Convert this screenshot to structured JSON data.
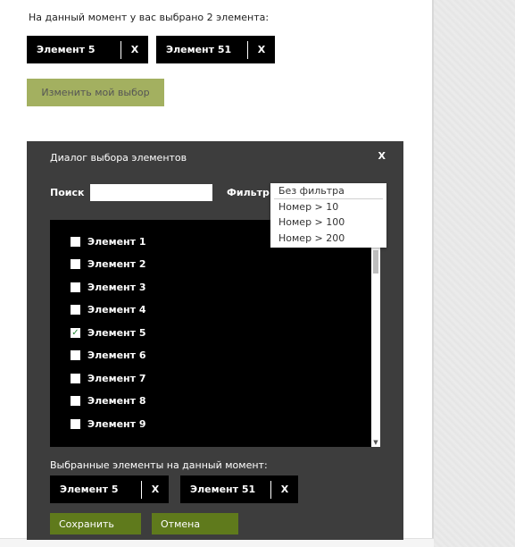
{
  "summary": {
    "text": "На данный момент у вас выбрано 2 элемента:",
    "chips": [
      {
        "label": "Элемент 5",
        "remove": "X"
      },
      {
        "label": "Элемент 51",
        "remove": "X"
      }
    ],
    "change_button": "Изменить мой выбор"
  },
  "dialog": {
    "title": "Диалог выбора элементов",
    "close": "X",
    "search_label": "Поиск",
    "search_value": "",
    "filter_label": "Фильтр",
    "filter_options": [
      "Без фильтра",
      "Номер > 10",
      "Номер > 100",
      "Номер > 200"
    ],
    "items": [
      {
        "label": "Элемент 1",
        "checked": false
      },
      {
        "label": "Элемент 2",
        "checked": false
      },
      {
        "label": "Элемент 3",
        "checked": false
      },
      {
        "label": "Элемент 4",
        "checked": false
      },
      {
        "label": "Элемент 5",
        "checked": true
      },
      {
        "label": "Элемент 6",
        "checked": false
      },
      {
        "label": "Элемент 7",
        "checked": false
      },
      {
        "label": "Элемент 8",
        "checked": false
      },
      {
        "label": "Элемент 9",
        "checked": false
      }
    ],
    "selected_label": "Выбранные элементы на данный момент:",
    "selected_chips": [
      {
        "label": "Элемент 5",
        "remove": "X"
      },
      {
        "label": "Элемент 51",
        "remove": "X"
      }
    ],
    "save_button": "Сохранить",
    "cancel_button": "Отмена",
    "check_mark": "✓"
  },
  "colors": {
    "dialog_bg": "#3d3d3d",
    "chip_bg": "#000000",
    "change_button_bg": "#a3b060",
    "action_button_bg": "#5f7a1c"
  }
}
